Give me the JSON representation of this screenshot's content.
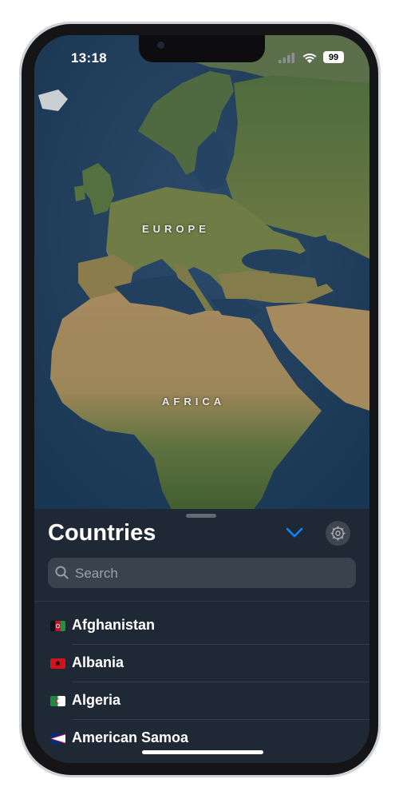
{
  "status_bar": {
    "time": "13:18",
    "battery": "99"
  },
  "map": {
    "labels": {
      "europe": "EUROPE",
      "africa": "AFRICA"
    }
  },
  "sheet": {
    "title": "Countries",
    "search": {
      "placeholder": "Search",
      "value": ""
    },
    "countries": [
      {
        "name": "Afghanistan",
        "flag_icon": "afghanistan-flag-icon"
      },
      {
        "name": "Albania",
        "flag_icon": "albania-flag-icon"
      },
      {
        "name": "Algeria",
        "flag_icon": "algeria-flag-icon"
      },
      {
        "name": "American Samoa",
        "flag_icon": "american-samoa-flag-icon"
      }
    ]
  },
  "colors": {
    "accent": "#0a84ff",
    "sheet_bg": "#1f2935",
    "search_bg": "#3a434d"
  }
}
